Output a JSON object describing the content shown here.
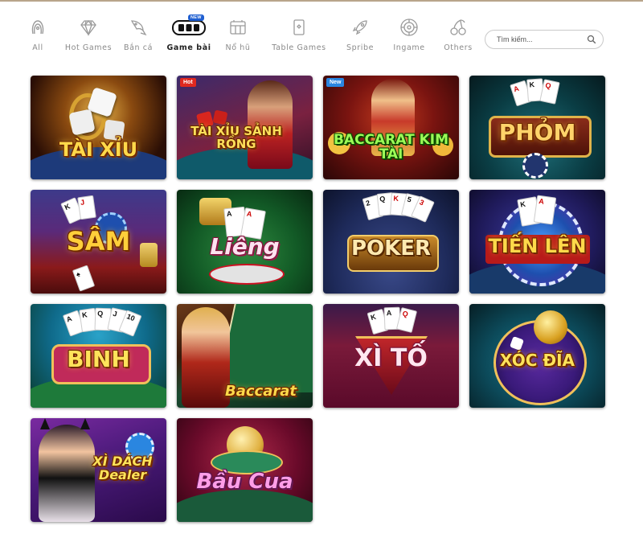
{
  "nav": {
    "items": [
      {
        "label": "All",
        "icon": "all-icon"
      },
      {
        "label": "Hot Games",
        "icon": "diamond-icon"
      },
      {
        "label": "Bắn cá",
        "icon": "fish-icon"
      },
      {
        "label": "Game bài",
        "icon": "cards-icon",
        "active": true,
        "badge": "NEW"
      },
      {
        "label": "Nổ hũ",
        "icon": "slot-icon"
      },
      {
        "label": "Table Games",
        "icon": "table-icon"
      },
      {
        "label": "Spribe",
        "icon": "rocket-icon"
      },
      {
        "label": "Ingame",
        "icon": "roulette-icon"
      },
      {
        "label": "Others",
        "icon": "cherry-icon"
      }
    ]
  },
  "search": {
    "placeholder": "Tìm kiếm..."
  },
  "games": [
    {
      "title": "TÀI XỈU",
      "tag": ""
    },
    {
      "title": "TÀI XỈU SẢNH RỒNG",
      "tag": "Hot"
    },
    {
      "title": "BACCARAT KIM TÀI",
      "tag": "New"
    },
    {
      "title": "PHỎM",
      "tag": ""
    },
    {
      "title": "SÂM",
      "tag": ""
    },
    {
      "title": "Liêng",
      "tag": ""
    },
    {
      "title": "POKER",
      "tag": ""
    },
    {
      "title": "TIẾN LÊN",
      "tag": ""
    },
    {
      "title": "BINH",
      "tag": ""
    },
    {
      "title": "Baccarat",
      "tag": ""
    },
    {
      "title": "XÌ TỐ",
      "tag": ""
    },
    {
      "title": "XÓC ĐĨA",
      "tag": ""
    },
    {
      "title": "XÌ DÁCH Dealer",
      "tag": ""
    },
    {
      "title": "Bầu Cua",
      "tag": ""
    }
  ],
  "colors": {
    "accent": "#1f5fd1",
    "hot": "#e0291f",
    "new": "#2a86e0"
  }
}
